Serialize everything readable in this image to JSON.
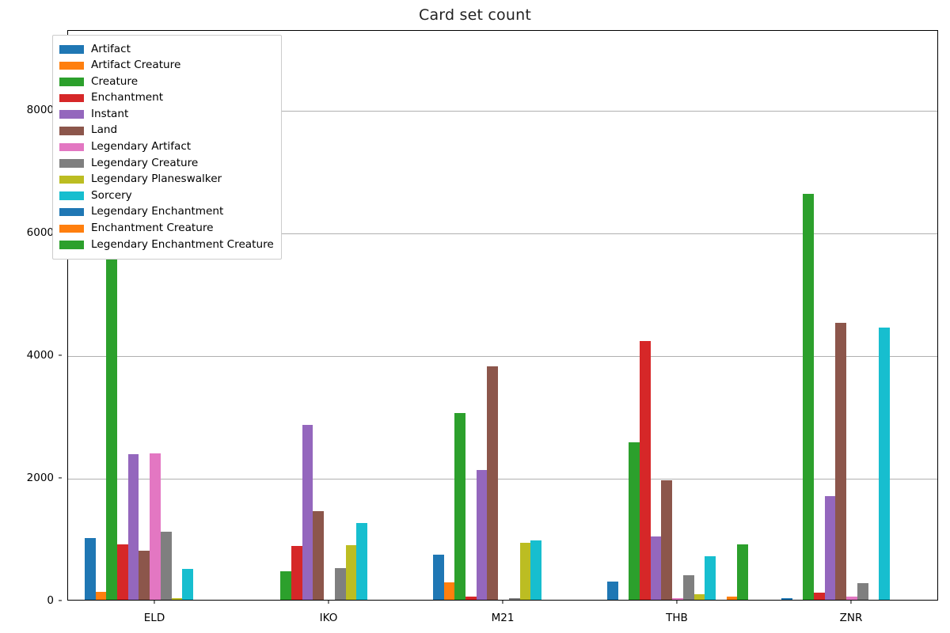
{
  "chart_data": {
    "type": "bar",
    "title": "Card set count",
    "xlabel": "",
    "ylabel": "",
    "categories": [
      "ELD",
      "IKO",
      "M21",
      "THB",
      "ZNR"
    ],
    "ylim": [
      0,
      9300
    ],
    "yticks": [
      0,
      2000,
      4000,
      6000,
      8000
    ],
    "ytick_labels": [
      "0",
      "2000",
      "4000",
      "6000",
      "8000"
    ],
    "grid": "horizontal",
    "legend_position": "upper left",
    "legend_title": "",
    "series": [
      {
        "name": "Artifact",
        "color": "#1f77b4",
        "values": [
          1010,
          0,
          740,
          300,
          20
        ]
      },
      {
        "name": "Artifact Creature",
        "color": "#ff7f0e",
        "values": [
          130,
          0,
          285,
          0,
          0
        ]
      },
      {
        "name": "Creature",
        "color": "#2ca02c",
        "values": [
          9150,
          460,
          3040,
          2570,
          6620
        ]
      },
      {
        "name": "Enchantment",
        "color": "#d62728",
        "values": [
          900,
          880,
          55,
          4220,
          120
        ]
      },
      {
        "name": "Instant",
        "color": "#9467bd",
        "values": [
          2370,
          2850,
          2120,
          1030,
          1690
        ]
      },
      {
        "name": "Land",
        "color": "#8c564b",
        "values": [
          800,
          1450,
          3800,
          1950,
          4520
        ]
      },
      {
        "name": "Legendary Artifact",
        "color": "#e377c2",
        "values": [
          2385,
          0,
          0,
          25,
          55
        ]
      },
      {
        "name": "Legendary Creature",
        "color": "#7f7f7f",
        "values": [
          1110,
          520,
          30,
          400,
          275
        ]
      },
      {
        "name": "Legendary Planeswalker",
        "color": "#bcbd22",
        "values": [
          25,
          890,
          930,
          85,
          0
        ]
      },
      {
        "name": "Sorcery",
        "color": "#17becf",
        "values": [
          500,
          1255,
          965,
          715,
          4440
        ]
      },
      {
        "name": "Legendary Enchantment",
        "color": "#1f77b4",
        "values": [
          0,
          0,
          0,
          0,
          0
        ]
      },
      {
        "name": "Enchantment Creature",
        "color": "#ff7f0e",
        "values": [
          0,
          0,
          0,
          55,
          0
        ]
      },
      {
        "name": "Legendary Enchantment Creature",
        "color": "#2ca02c",
        "values": [
          0,
          0,
          0,
          900,
          0
        ]
      }
    ]
  }
}
